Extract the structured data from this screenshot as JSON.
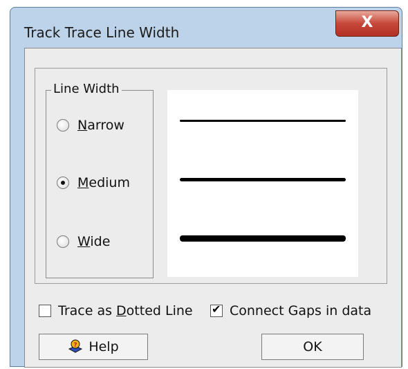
{
  "window": {
    "title": "Track Trace Line Width",
    "close_label": "X"
  },
  "group": {
    "label": "Line Width"
  },
  "options": [
    {
      "key": "N",
      "rest": "arrow",
      "selected": false
    },
    {
      "key": "M",
      "rest": "edium",
      "selected": true
    },
    {
      "key": "W",
      "rest": "ide",
      "selected": false
    }
  ],
  "checkboxes": [
    {
      "pre": "Trace as ",
      "key": "D",
      "post": "otted Line",
      "checked": false
    },
    {
      "pre": "Connect Gaps in data",
      "key": "",
      "post": "",
      "checked": true
    }
  ],
  "buttons": {
    "help_label": "Help",
    "ok_label": "OK"
  }
}
